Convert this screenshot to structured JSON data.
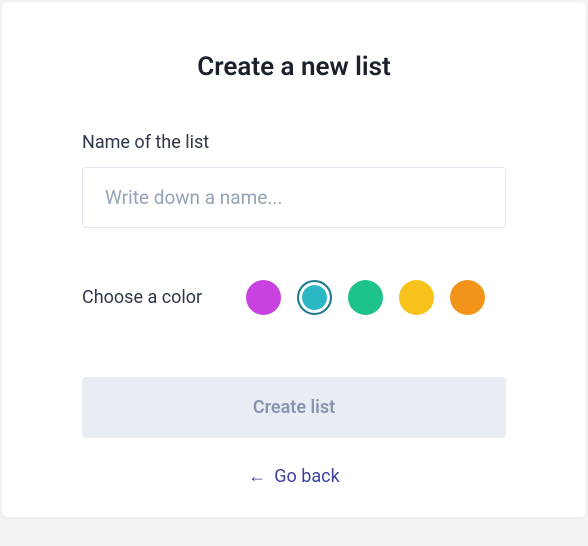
{
  "modal": {
    "title": "Create a new list",
    "name_field": {
      "label": "Name of the list",
      "placeholder": "Write down a name...",
      "value": ""
    },
    "color_field": {
      "label": "Choose a color",
      "options": [
        {
          "hex": "#c842e0",
          "selected": false
        },
        {
          "hex": "#2bb7c4",
          "selected": true
        },
        {
          "hex": "#1ec28b",
          "selected": false
        },
        {
          "hex": "#f7c21b",
          "selected": false
        },
        {
          "hex": "#f2941a",
          "selected": false
        }
      ]
    },
    "submit_label": "Create list",
    "back_link": {
      "arrow": "←",
      "label": "Go back"
    }
  }
}
